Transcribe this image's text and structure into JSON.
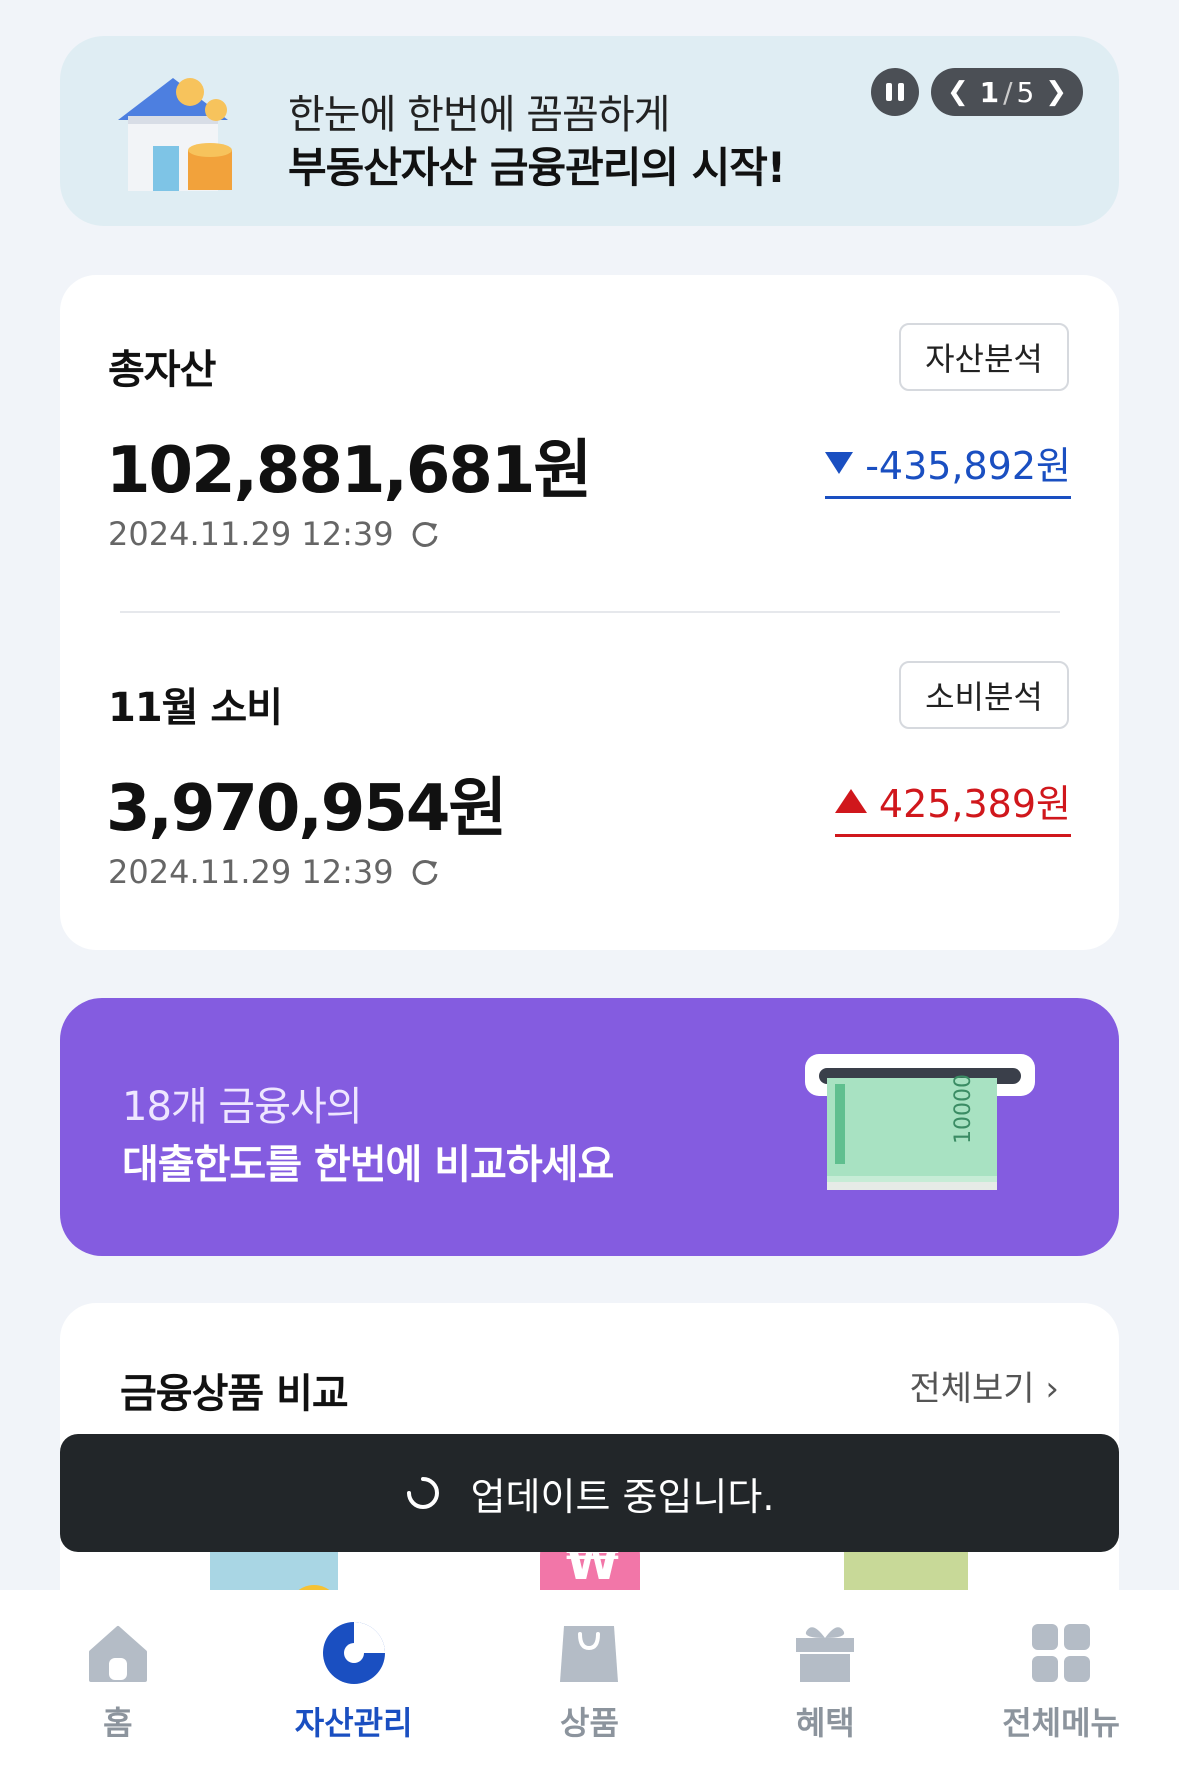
{
  "banner": {
    "line1": "한눈에 한번에 꼼꼼하게",
    "line2": "부동산자산 금융관리의 시작!",
    "pager_current": "1",
    "pager_sep": "/",
    "pager_total": "5"
  },
  "assets": {
    "title": "총자산",
    "analysis_button": "자산분석",
    "amount": "102,881,681원",
    "change": "-435,892원",
    "change_direction": "down",
    "updated_at": "2024.11.29 12:39"
  },
  "spending": {
    "title": "11월 소비",
    "analysis_button": "소비분석",
    "amount": "3,970,954원",
    "change": "425,389원",
    "change_direction": "up",
    "updated_at": "2024.11.29 12:39"
  },
  "loan_banner": {
    "line1": "18개 금융사의",
    "line2": "대출한도를 한번에 비교하세요",
    "bill_text": "10000"
  },
  "compare": {
    "title": "금융상품 비교",
    "view_all": "전체보기",
    "view_all_chevron": "›"
  },
  "toast": {
    "message": "업데이트 중입니다."
  },
  "nav": {
    "items": [
      {
        "label": "홈",
        "icon": "home-icon",
        "active": false
      },
      {
        "label": "자산관리",
        "icon": "pie-chart-icon",
        "active": true
      },
      {
        "label": "상품",
        "icon": "shopping-bag-icon",
        "active": false
      },
      {
        "label": "혜택",
        "icon": "gift-icon",
        "active": false
      },
      {
        "label": "전체메뉴",
        "icon": "grid-menu-icon",
        "active": false
      }
    ]
  },
  "colors": {
    "accent": "#1a4fc1",
    "increase": "#d0171c",
    "decrease": "#1a4fc1",
    "loan_banner_bg": "#845ce0",
    "promo_bg": "#dfedf3"
  }
}
